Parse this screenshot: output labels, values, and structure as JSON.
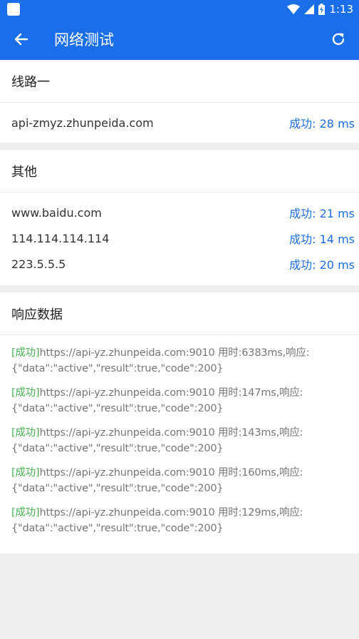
{
  "status": {
    "time": "1:13"
  },
  "appbar": {
    "title": "网络测试"
  },
  "section1": {
    "title": "线路一",
    "rows": [
      {
        "host": "api-zmyz.zhunpeida.com",
        "result": "成功: 28 ms"
      }
    ]
  },
  "section2": {
    "title": "其他",
    "rows": [
      {
        "host": "www.baidu.com",
        "result": "成功: 21 ms"
      },
      {
        "host": "114.114.114.114",
        "result": "成功: 14 ms"
      },
      {
        "host": "223.5.5.5",
        "result": "成功: 20 ms"
      }
    ]
  },
  "section3": {
    "title": "响应数据",
    "logs": [
      {
        "tag": "[成功]",
        "line": "https://api-yz.zhunpeida.com:9010 用时:6383ms,响应:",
        "body": "{\"data\":\"active\",\"result\":true,\"code\":200}"
      },
      {
        "tag": "[成功]",
        "line": "https://api-yz.zhunpeida.com:9010 用时:147ms,响应:",
        "body": "{\"data\":\"active\",\"result\":true,\"code\":200}"
      },
      {
        "tag": "[成功]",
        "line": "https://api-yz.zhunpeida.com:9010 用时:143ms,响应:",
        "body": "{\"data\":\"active\",\"result\":true,\"code\":200}"
      },
      {
        "tag": "[成功]",
        "line": "https://api-yz.zhunpeida.com:9010 用时:160ms,响应:",
        "body": "{\"data\":\"active\",\"result\":true,\"code\":200}"
      },
      {
        "tag": "[成功]",
        "line": "https://api-yz.zhunpeida.com:9010 用时:129ms,响应:",
        "body": "{\"data\":\"active\",\"result\":true,\"code\":200}"
      }
    ]
  },
  "colors": {
    "primary": "#1a6fe8",
    "success": "#4caf50",
    "background": "#eeeeee"
  },
  "icons": [
    "app-icon",
    "wifi-icon",
    "signal-icon",
    "battery-icon",
    "back-arrow-icon",
    "refresh-icon"
  ]
}
